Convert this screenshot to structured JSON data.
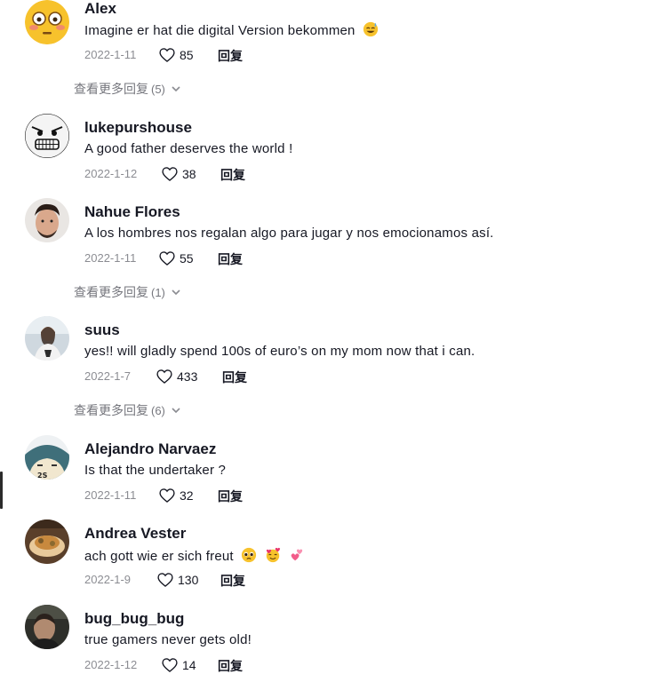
{
  "comments": [
    {
      "username": "Alex",
      "text": "Imagine er hat die digital Version bekommen",
      "date": "2022-1-11",
      "likes": "85",
      "reply_label": "回复",
      "emojis": [
        "smiling-face-with-sweat-emoji"
      ],
      "avatar": "flushed-face-emoji-avatar"
    },
    {
      "username": "lukepurshouse",
      "text": "A good father deserves the world !",
      "date": "2022-1-12",
      "likes": "38",
      "reply_label": "回复",
      "avatar": "rage-face-meme-avatar"
    },
    {
      "username": "Nahue Flores",
      "text": "A los hombres nos regalan algo para jugar y nos emocionamos así.",
      "date": "2022-1-11",
      "likes": "55",
      "reply_label": "回复",
      "avatar": "man-portrait-avatar"
    },
    {
      "username": "suus",
      "text": "yes!! will gladly spend 100s of euro’s on my mom now that i can.",
      "date": "2022-1-7",
      "likes": "433",
      "reply_label": "回复",
      "avatar": "woman-photo-avatar"
    },
    {
      "username": "Alejandro Narvaez",
      "text": "Is that the undertaker ?",
      "date": "2022-1-11",
      "likes": "32",
      "reply_label": "回复",
      "avatar": "cartoon-character-avatar"
    },
    {
      "username": "Andrea Vester",
      "text": "ach gott wie er sich freut",
      "date": "2022-1-9",
      "likes": "130",
      "reply_label": "回复",
      "emojis": [
        "pleading-face-emoji",
        "smiling-face-with-hearts-emoji",
        "two-hearts-emoji"
      ],
      "avatar": "food-photo-avatar"
    },
    {
      "username": "bug_bug_bug",
      "text": "true gamers never gets old!",
      "date": "2022-1-12",
      "likes": "14",
      "reply_label": "回复",
      "avatar": "man-dark-photo-avatar"
    }
  ],
  "view_more": [
    {
      "label": "查看更多回复",
      "count": "(5)"
    },
    {
      "label": "查看更多回复",
      "count": "(1)"
    },
    {
      "label": "查看更多回复",
      "count": "(6)"
    }
  ],
  "colors": {
    "text": "#161823",
    "muted": "#8a8b91",
    "like_outline": "#161823"
  }
}
